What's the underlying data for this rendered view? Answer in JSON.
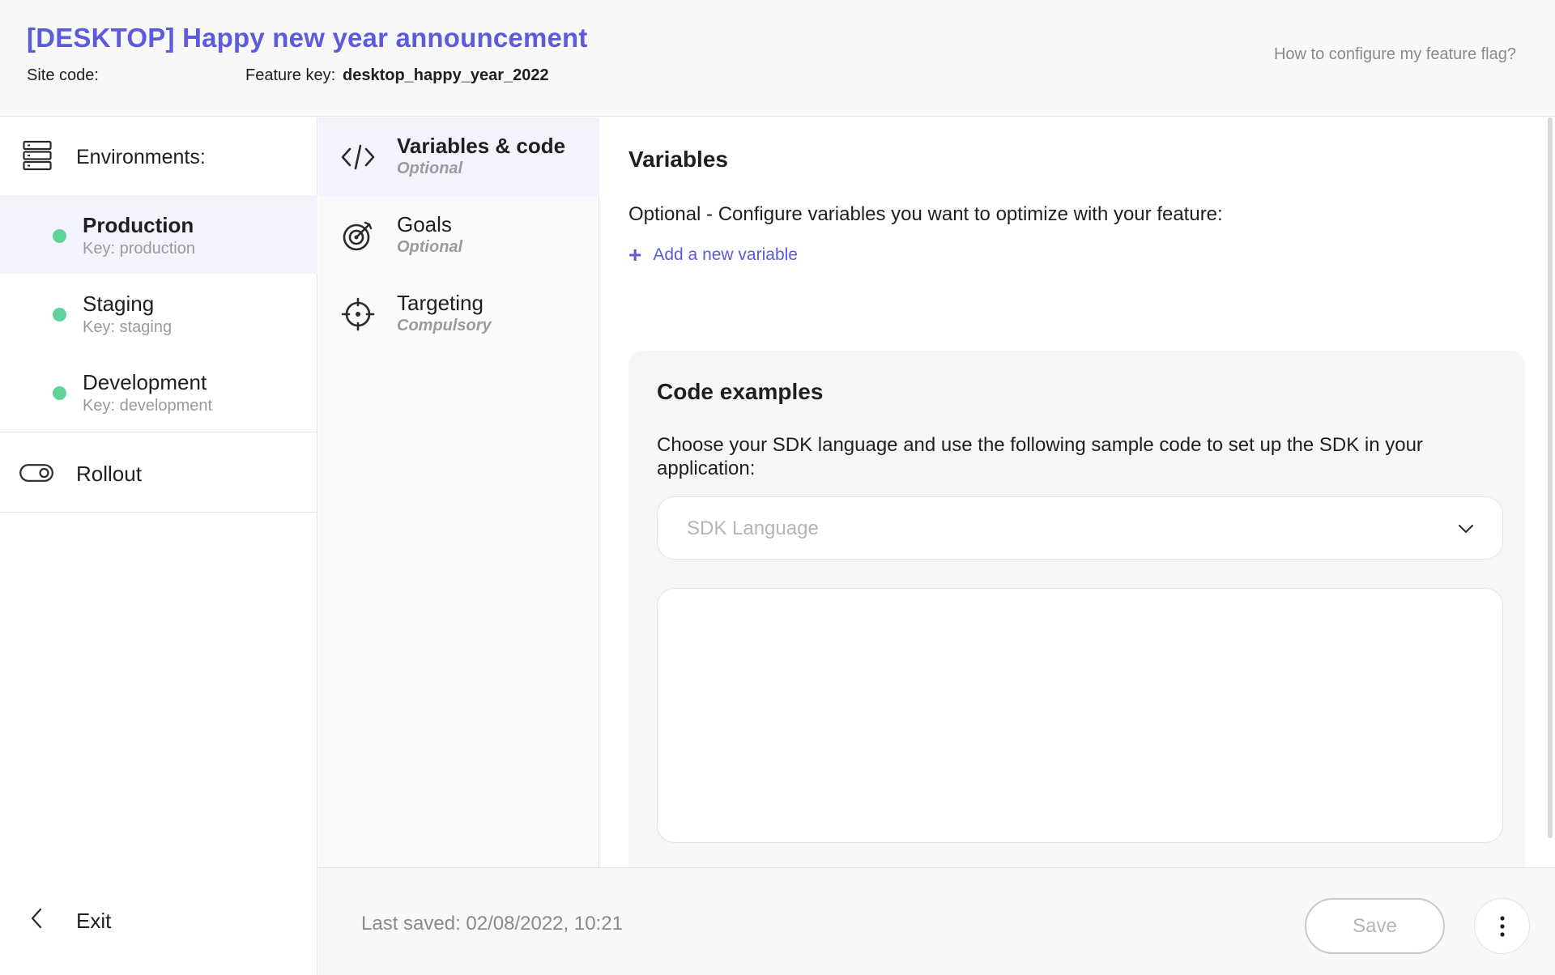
{
  "header": {
    "title": "[DESKTOP] Happy new year announcement",
    "site_code_label": "Site code:",
    "feature_key_label": "Feature key:",
    "feature_key_value": "desktop_happy_year_2022",
    "help_link": "How to configure my feature flag?"
  },
  "sidebar": {
    "environments_label": "Environments:",
    "environments": [
      {
        "name": "Production",
        "key": "Key: production",
        "active": true,
        "status_color": "#5fd49a"
      },
      {
        "name": "Staging",
        "key": "Key: staging",
        "active": false,
        "status_color": "#5fd49a"
      },
      {
        "name": "Development",
        "key": "Key: development",
        "active": false,
        "status_color": "#5fd49a"
      }
    ],
    "rollout_label": "Rollout",
    "exit_label": "Exit"
  },
  "steps": [
    {
      "name": "Variables & code",
      "sub": "Optional",
      "icon": "code-icon",
      "active": true
    },
    {
      "name": "Goals",
      "sub": "Optional",
      "icon": "target-icon",
      "active": false
    },
    {
      "name": "Targeting",
      "sub": "Compulsory",
      "icon": "crosshair-icon",
      "active": false
    }
  ],
  "main": {
    "variables_title": "Variables",
    "variables_desc": "Optional - Configure variables you want to optimize with your feature:",
    "add_variable": "Add a new variable",
    "code_title": "Code examples",
    "code_desc": "Choose your SDK language and use the following sample code to set up the SDK in your application:",
    "sdk_placeholder": "SDK Language"
  },
  "footer": {
    "last_saved": "Last saved: 02/08/2022, 10:21",
    "save_label": "Save"
  },
  "colors": {
    "accent": "#5b5bdc",
    "status_green": "#5fd49a",
    "active_bg": "#f3f3fd"
  }
}
